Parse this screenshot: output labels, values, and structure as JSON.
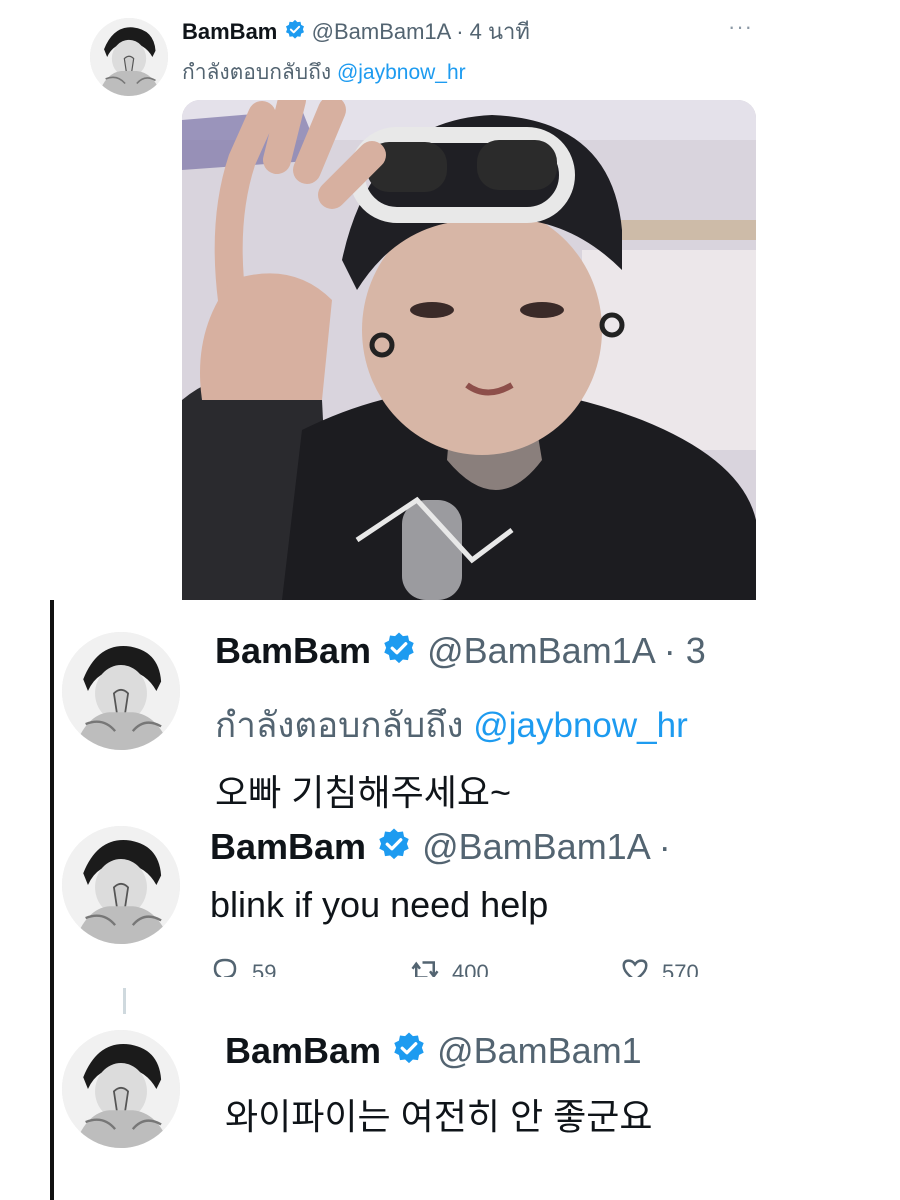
{
  "tweets": [
    {
      "name": "BamBam",
      "handle": "@BamBam1A · 4 นาที",
      "reply_prefix": "กำลังตอบกลับถึง",
      "reply_to": "@jaybnow_hr",
      "more": "···"
    },
    {
      "name": "BamBam",
      "handle": "@BamBam1A · 3 ",
      "reply_prefix": "กำลังตอบกลับถึง",
      "reply_to": "@jaybnow_hr",
      "text": "오빠 기침해주세요~"
    },
    {
      "name": "BamBam",
      "handle": "@BamBam1A ·",
      "text": "blink if you need help",
      "actions": {
        "replies": "59",
        "retweets": "400",
        "likes": "570"
      }
    },
    {
      "name": "BamBam",
      "handle": "@BamBam1",
      "text": "와이파이는 여전히 안 좋군요"
    }
  ],
  "colors": {
    "accent": "#1d9bf0",
    "muted": "#536471",
    "text": "#0f1419"
  },
  "icons": [
    "verified-badge-icon",
    "more-icon",
    "reply-icon",
    "retweet-icon",
    "like-icon"
  ]
}
